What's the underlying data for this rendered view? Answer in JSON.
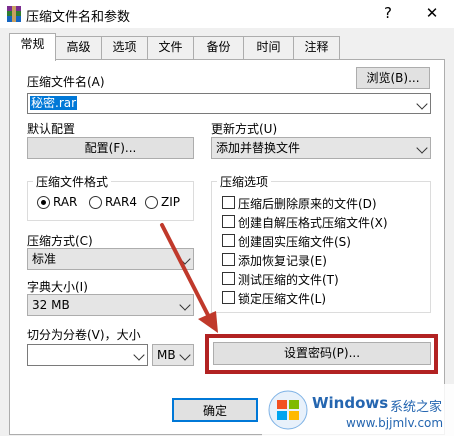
{
  "window": {
    "title": "压缩文件名和参数",
    "help_symbol": "?",
    "close_symbol": "✕"
  },
  "tabs": [
    {
      "label": "常规"
    },
    {
      "label": "高级"
    },
    {
      "label": "选项"
    },
    {
      "label": "文件"
    },
    {
      "label": "备份"
    },
    {
      "label": "时间"
    },
    {
      "label": "注释"
    }
  ],
  "archive": {
    "name_label": "压缩文件名(A)",
    "browse_label": "浏览(B)...",
    "name_value": "秘密.rar"
  },
  "profile": {
    "label": "默认配置",
    "button": "配置(F)..."
  },
  "update": {
    "label": "更新方式(U)",
    "value": "添加并替换文件"
  },
  "format": {
    "title": "压缩文件格式",
    "options": [
      {
        "label": "RAR",
        "selected": true
      },
      {
        "label": "RAR4",
        "selected": false
      },
      {
        "label": "ZIP",
        "selected": false
      }
    ]
  },
  "method": {
    "label": "压缩方式(C)",
    "value": "标准"
  },
  "dict": {
    "label": "字典大小(I)",
    "value": "32 MB"
  },
  "split": {
    "label": "切分为分卷(V)，大小",
    "value": "",
    "unit": "MB"
  },
  "options": {
    "title": "压缩选项",
    "items": [
      {
        "label": "压缩后删除原来的文件(D)",
        "checked": false
      },
      {
        "label": "创建自解压格式压缩文件(X)",
        "checked": false
      },
      {
        "label": "创建固实压缩文件(S)",
        "checked": false
      },
      {
        "label": "添加恢复记录(E)",
        "checked": false
      },
      {
        "label": "测试压缩的文件(T)",
        "checked": false
      },
      {
        "label": "锁定压缩文件(L)",
        "checked": false
      }
    ]
  },
  "password_button": "设置密码(P)...",
  "ok_button": "确定",
  "watermark": {
    "title": "Windows",
    "title_cn": "系统之家",
    "url": "www.bjjmlv.com"
  },
  "colors": {
    "highlight_box": "#b22222",
    "arrow": "#c0392b",
    "selection": "#0078d7",
    "brand": "#2566b0"
  }
}
